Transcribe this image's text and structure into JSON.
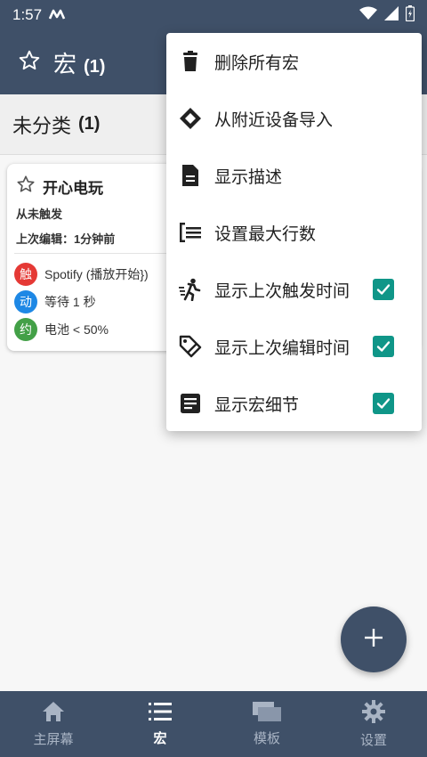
{
  "status_bar": {
    "time": "1:57",
    "logo": "M"
  },
  "app_bar": {
    "title": "宏",
    "count": "(1)"
  },
  "category": {
    "name": "未分类",
    "count": "(1)"
  },
  "macro_card": {
    "name": "开心电玩",
    "last_triggered": "从未触发",
    "last_edited": "上次编辑：1分钟前",
    "items": [
      {
        "badge": "触",
        "text": "Spotify (播放开始})",
        "color": "#e53935"
      },
      {
        "badge": "动",
        "text": "等待 1 秒",
        "color": "#1e88e5"
      },
      {
        "badge": "约",
        "text": "电池 < 50%",
        "color": "#43a047"
      }
    ]
  },
  "menu": {
    "items": [
      {
        "label": "删除所有宏",
        "icon": "trash-icon",
        "checked": false
      },
      {
        "label": "从附近设备导入",
        "icon": "import-nearby-icon",
        "checked": false
      },
      {
        "label": "显示描述",
        "icon": "document-icon",
        "checked": false
      },
      {
        "label": "设置最大行数",
        "icon": "list-lines-icon",
        "checked": false
      },
      {
        "label": "显示上次触发时间",
        "icon": "running-icon",
        "checked": true
      },
      {
        "label": "显示上次编辑时间",
        "icon": "tag-edit-icon",
        "checked": true
      },
      {
        "label": "显示宏细节",
        "icon": "details-icon",
        "checked": true
      }
    ]
  },
  "bottom_nav": {
    "items": [
      {
        "label": "主屏幕",
        "icon": "home-icon",
        "active": false
      },
      {
        "label": "宏",
        "icon": "list-icon",
        "active": true
      },
      {
        "label": "模板",
        "icon": "templates-icon",
        "active": false
      },
      {
        "label": "设置",
        "icon": "gear-icon",
        "active": false
      }
    ]
  },
  "colors": {
    "primary": "#3f5068",
    "accent": "#0f9688"
  }
}
